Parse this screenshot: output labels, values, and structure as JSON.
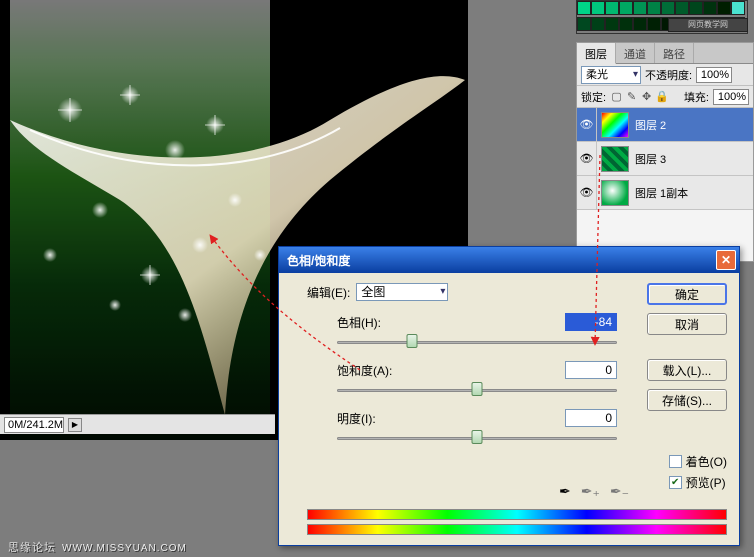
{
  "status": {
    "zoom": "0M/241.2M",
    "play_icon": "▶"
  },
  "palette_tag": "网页教学网",
  "swatch_colors": [
    "#00d488",
    "#00c87e",
    "#00b870",
    "#00a862",
    "#009454",
    "#008246",
    "#006e38",
    "#005a2a",
    "#00461c",
    "#00320e",
    "#001e00",
    "#4ae2d0",
    "#004820",
    "#004018",
    "#003810",
    "#00300c",
    "#002808",
    "#002004",
    "#001802",
    "#001000",
    "#000800",
    "#008070",
    "#007060",
    "#006050"
  ],
  "layers": {
    "tabs": [
      "图层",
      "通道",
      "路径"
    ],
    "blend_mode": "柔光",
    "opacity_label": "不透明度:",
    "opacity_value": "100%",
    "lock_label": "锁定:",
    "fill_label": "填充:",
    "fill_value": "100%",
    "items": [
      {
        "name": "图层 2",
        "thumb": "gradient",
        "selected": true
      },
      {
        "name": "图层 3",
        "thumb": "green-pattern",
        "selected": false
      },
      {
        "name": "图层 1副本",
        "thumb": "swirl",
        "selected": false
      }
    ]
  },
  "dialog": {
    "title": "色相/饱和度",
    "edit_label": "编辑(E):",
    "edit_value": "全图",
    "hue_label": "色相(H):",
    "hue_value": "-84",
    "sat_label": "饱和度(A):",
    "sat_value": "0",
    "light_label": "明度(I):",
    "light_value": "0",
    "btn_ok": "确定",
    "btn_cancel": "取消",
    "btn_load": "载入(L)...",
    "btn_save": "存储(S)...",
    "cb_colorize": "着色(O)",
    "cb_preview": "预览(P)"
  },
  "footer": {
    "forum": "思缘论坛",
    "url": "WWW.MISSYUAN.COM"
  }
}
